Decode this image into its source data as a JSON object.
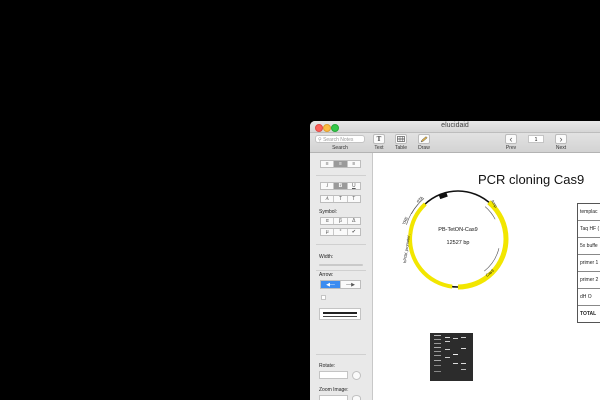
{
  "window": {
    "title": "elucidaid"
  },
  "search": {
    "placeholder": "Search Notes"
  },
  "toolbar": {
    "search_label": "Search",
    "text_label": "Text",
    "table_label": "Table",
    "draw_label": "Draw",
    "prev_label": "Prev",
    "next_label": "Next",
    "page_number": "1"
  },
  "sidebar": {
    "symbol_label": "Symbol:",
    "symbols": [
      "α",
      "β",
      "Δ",
      "μ",
      "°",
      "✔"
    ],
    "width_label": "Width:",
    "arrow_label": "Arrow:",
    "rotate_label": "Rotate:",
    "zoom_label": "Zoom Image:"
  },
  "document": {
    "title": "PCR cloning Cas9",
    "plasmid": {
      "name": "PB-TetON-Cas9",
      "size": "12527 bp",
      "features": [
        "Amp",
        "TRE",
        "rtTA",
        "Cas9",
        "hPGK promoter"
      ]
    },
    "reaction_table": [
      {
        "label": "templac"
      },
      {
        "label": "Taq HF ("
      },
      {
        "label": "5x buffe"
      },
      {
        "label": "primer 1"
      },
      {
        "label": "primer 2"
      },
      {
        "label": "dH O"
      },
      {
        "label": "TOTAL"
      }
    ]
  },
  "colors": {
    "feature": "#f2e600",
    "selected_arrow": "#3c8cf0"
  }
}
